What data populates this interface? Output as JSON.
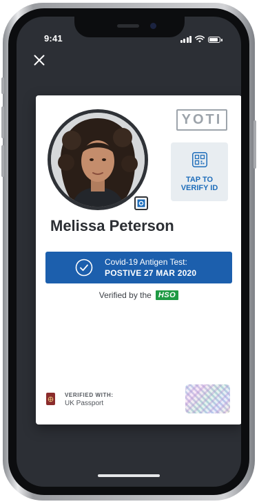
{
  "status_bar": {
    "time": "9:41"
  },
  "card": {
    "logo_text": "YOTI",
    "verify": {
      "label": "TAP TO VERIFY ID"
    },
    "name": "Melissa Peterson",
    "test": {
      "line1": "Covid-19 Antigen Test:",
      "line2": "POSTIVE 27 MAR 2020"
    },
    "verified_by": {
      "label": "Verified by the",
      "badge": "HSO"
    },
    "verified_with": {
      "label": "VERIFIED WITH:",
      "value": "UK Passport"
    }
  },
  "colors": {
    "screen_bg": "#2c2f35",
    "banner_blue": "#1c5fad",
    "verify_text_blue": "#1e6dba",
    "badge_green": "#1f9a44",
    "logo_gray": "#9da4ab"
  },
  "icons": [
    "close-icon",
    "qr-code-icon",
    "check-circle-icon",
    "passport-icon",
    "signal-icon",
    "wifi-icon",
    "battery-icon",
    "id-badge-icon"
  ]
}
